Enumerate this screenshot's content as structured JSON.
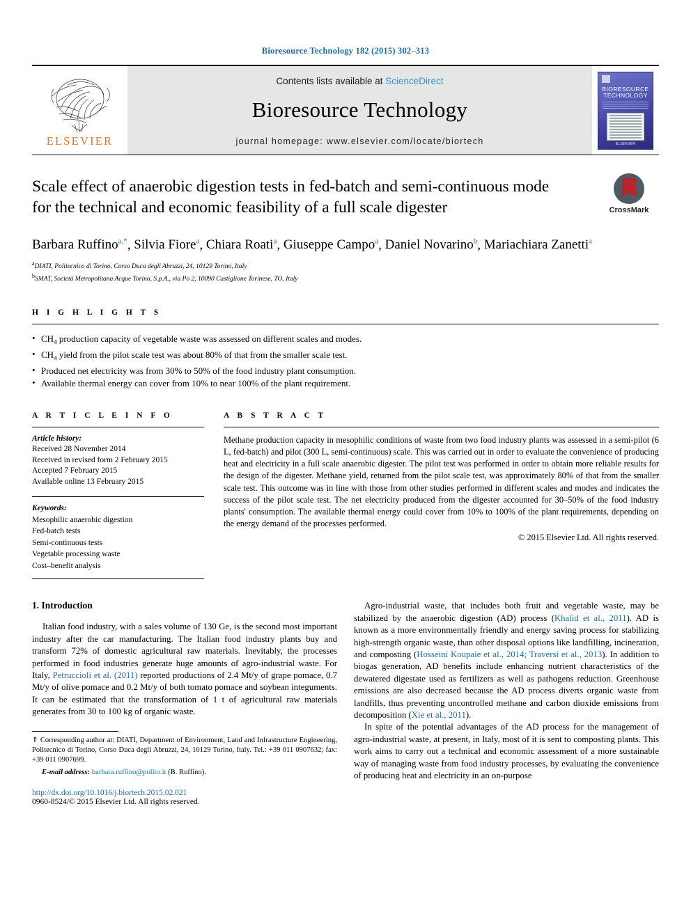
{
  "running_head": "Bioresource Technology 182 (2015) 302–313",
  "masthead": {
    "publisher": "ELSEVIER",
    "contents_prefix": "Contents lists available at ",
    "contents_link": "ScienceDirect",
    "journal_title": "Bioresource Technology",
    "homepage": "journal homepage: www.elsevier.com/locate/biortech",
    "cover_title": "BIORESOURCE TECHNOLOGY",
    "cover_footer": "ELSEVIER"
  },
  "crossmark": {
    "label": "CrossMark"
  },
  "title": "Scale effect of anaerobic digestion tests in fed-batch and semi-continuous mode for the technical and economic feasibility of a full scale digester",
  "authors": [
    {
      "name": "Barbara Ruffino",
      "marks": "a,*"
    },
    {
      "name": "Silvia Fiore",
      "marks": "a"
    },
    {
      "name": "Chiara Roati",
      "marks": "a"
    },
    {
      "name": "Giuseppe Campo",
      "marks": "a"
    },
    {
      "name": "Daniel Novarino",
      "marks": "b"
    },
    {
      "name": "Mariachiara Zanetti",
      "marks": "a"
    }
  ],
  "affiliations": [
    {
      "mark": "a",
      "text": "DIATI, Politecnico di Torino, Corso Duca degli Abruzzi, 24, 10129 Torino, Italy"
    },
    {
      "mark": "b",
      "text": "SMAT, Società Metropolitana Acque Torino, S.p.A., via Po 2, 10090 Castiglione Torinese, TO, Italy"
    }
  ],
  "highlights": {
    "heading": "H I G H L I G H T S",
    "items": [
      "CH4 production capacity of vegetable waste was assessed on different scales and modes.",
      "CH4 yield from the pilot scale test was about 80% of that from the smaller scale test.",
      "Produced net electricity was from 30% to 50% of the food industry plant consumption.",
      "Available thermal energy can cover from 10% to near 100% of the plant requirement."
    ]
  },
  "article_info": {
    "heading": "A R T I C L E    I N F O",
    "history_label": "Article history:",
    "history": [
      "Received 28 November 2014",
      "Received in revised form 2 February 2015",
      "Accepted 7 February 2015",
      "Available online 13 February 2015"
    ],
    "keywords_label": "Keywords:",
    "keywords": [
      "Mesophilic anaerobic digestion",
      "Fed-batch tests",
      "Semi-continuous tests",
      "Vegetable processing waste",
      "Cost–benefit analysis"
    ]
  },
  "abstract": {
    "heading": "A B S T R A C T",
    "text": "Methane production capacity in mesophilic conditions of waste from two food industry plants was assessed in a semi-pilot (6 L, fed-batch) and pilot (300 L, semi-continuous) scale. This was carried out in order to evaluate the convenience of producing heat and electricity in a full scale anaerobic digester. The pilot test was performed in order to obtain more reliable results for the design of the digester. Methane yield, returned from the pilot scale test, was approximately 80% of that from the smaller scale test. This outcome was in line with those from other studies performed in different scales and modes and indicates the success of the pilot scale test. The net electricity produced from the digester accounted for 30–50% of the food industry plants' consumption. The available thermal energy could cover from 10% to 100% of the plant requirements, depending on the energy demand of the processes performed.",
    "copyright": "© 2015 Elsevier Ltd. All rights reserved."
  },
  "introduction": {
    "heading": "1. Introduction",
    "left_paragraph_1_a": "Italian food industry, with a sales volume of 130 Ge, is the second most important industry after the car manufacturing. The Italian food industry plants buy and transform 72% of domestic agricultural raw materials. Inevitably, the processes performed in food industries generate huge amounts of agro-industrial waste. For Italy, ",
    "left_ref_1": "Petruccioli et al. (2011)",
    "left_paragraph_1_b": " reported productions of 2.4 Mt/y of grape pomace, 0.7 Mt/y of olive pomace and 0.2 Mt/y of both tomato pomace and soybean integuments. It can be estimated that the transformation of 1 t of agricultural raw materials generates from 30 to 100 kg of organic waste.",
    "right_paragraph_1_a": "Agro-industrial waste, that includes both fruit and vegetable waste, may be stabilized by the anaerobic digestion (AD) process (",
    "right_ref_1": "Khalid et al., 2011",
    "right_paragraph_1_b": "). AD is known as a more environmentally friendly and energy saving process for stabilizing high-strength organic waste, than other disposal options like landfilling, incineration, and composting (",
    "right_ref_2": "Hosseini Koupaie et al., 2014; Traversi et al., 2013",
    "right_paragraph_1_c": "). In addition to biogas generation, AD benefits include enhancing nutrient characteristics of the dewatered digestate used as fertilizers as well as pathogens reduction. Greenhouse emissions are also decreased because the AD process diverts organic waste from landfills, thus preventing uncontrolled methane and carbon dioxide emissions from decomposition (",
    "right_ref_3": "Xie et al., 2011",
    "right_paragraph_1_d": ").",
    "right_paragraph_2": "In spite of the potential advantages of the AD process for the management of agro-industrial waste, at present, in Italy, most of it is sent to composting plants. This work aims to carry out a technical and economic assessment of a more sustainable way of managing waste from food industry processes, by evaluating the convenience of producing heat and electricity in an on-purpose"
  },
  "footer": {
    "corresponding_mark": "⇑",
    "corresponding_text": " Corresponding author at: DIATI, Department of Environment, Land and Infrastructure Engineering, Politecnico di Torino, Corso Duca degli Abruzzi, 24, 10129 Torino, Italy. Tel.: +39 011 0907632; fax: +39 011 0907699.",
    "email_label": "E-mail address:",
    "email": "barbara.ruffino@polito.it",
    "email_suffix": " (B. Ruffino).",
    "doi": "http://dx.doi.org/10.1016/j.biortech.2015.02.021",
    "issn": "0960-8524/© 2015 Elsevier Ltd. All rights reserved."
  },
  "colors": {
    "link": "#1a6ea8",
    "sciencedirect": "#3a8fd0",
    "elsevier_orange": "#E87722"
  }
}
